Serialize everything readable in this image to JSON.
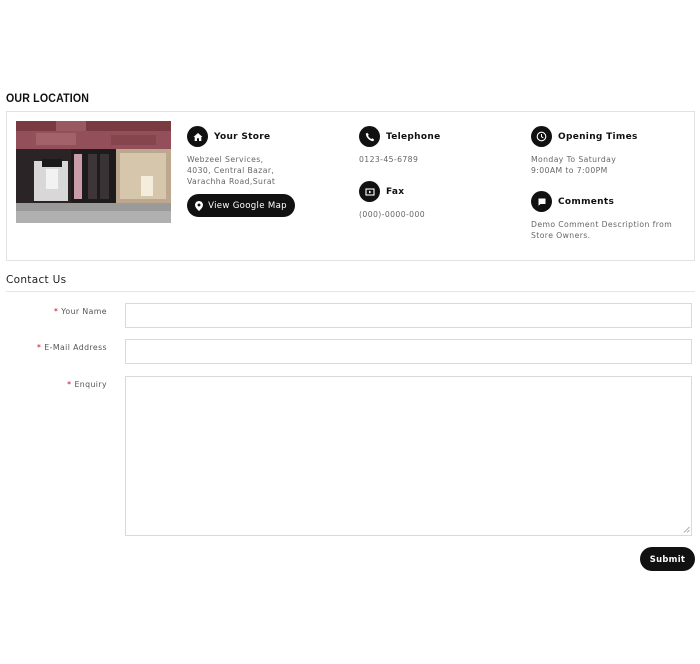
{
  "location": {
    "heading": "OUR LOCATION",
    "store": {
      "title": "Your Store",
      "address_lines": [
        "Webzeel Services,",
        "4030, Central Bazar,",
        "Varachha Road,Surat"
      ],
      "map_button_label": "View Google Map"
    },
    "telephone": {
      "title": "Telephone",
      "value": "0123-45-6789"
    },
    "fax": {
      "title": "Fax",
      "value": "(000)-0000-000"
    },
    "opening_times": {
      "title": "Opening Times",
      "lines": [
        "Monday To Saturday",
        "9:00AM to 7:00PM"
      ]
    },
    "comments": {
      "title": "Comments",
      "lines": [
        "Demo Comment Description from",
        "Store Owners."
      ]
    }
  },
  "contact": {
    "heading": "Contact Us",
    "required_marker": "*",
    "fields": [
      {
        "label": "Your Name",
        "value": ""
      },
      {
        "label": "E-Mail Address",
        "value": ""
      },
      {
        "label": "Enquiry",
        "value": ""
      }
    ],
    "submit_label": "Submit"
  },
  "colors": {
    "button_bg": "#111111",
    "required": "#d0021b",
    "border": "#e2e2e2"
  },
  "icons": [
    "home-icon",
    "phone-icon",
    "fax-icon",
    "clock-icon",
    "comment-icon",
    "map-pin-icon"
  ]
}
